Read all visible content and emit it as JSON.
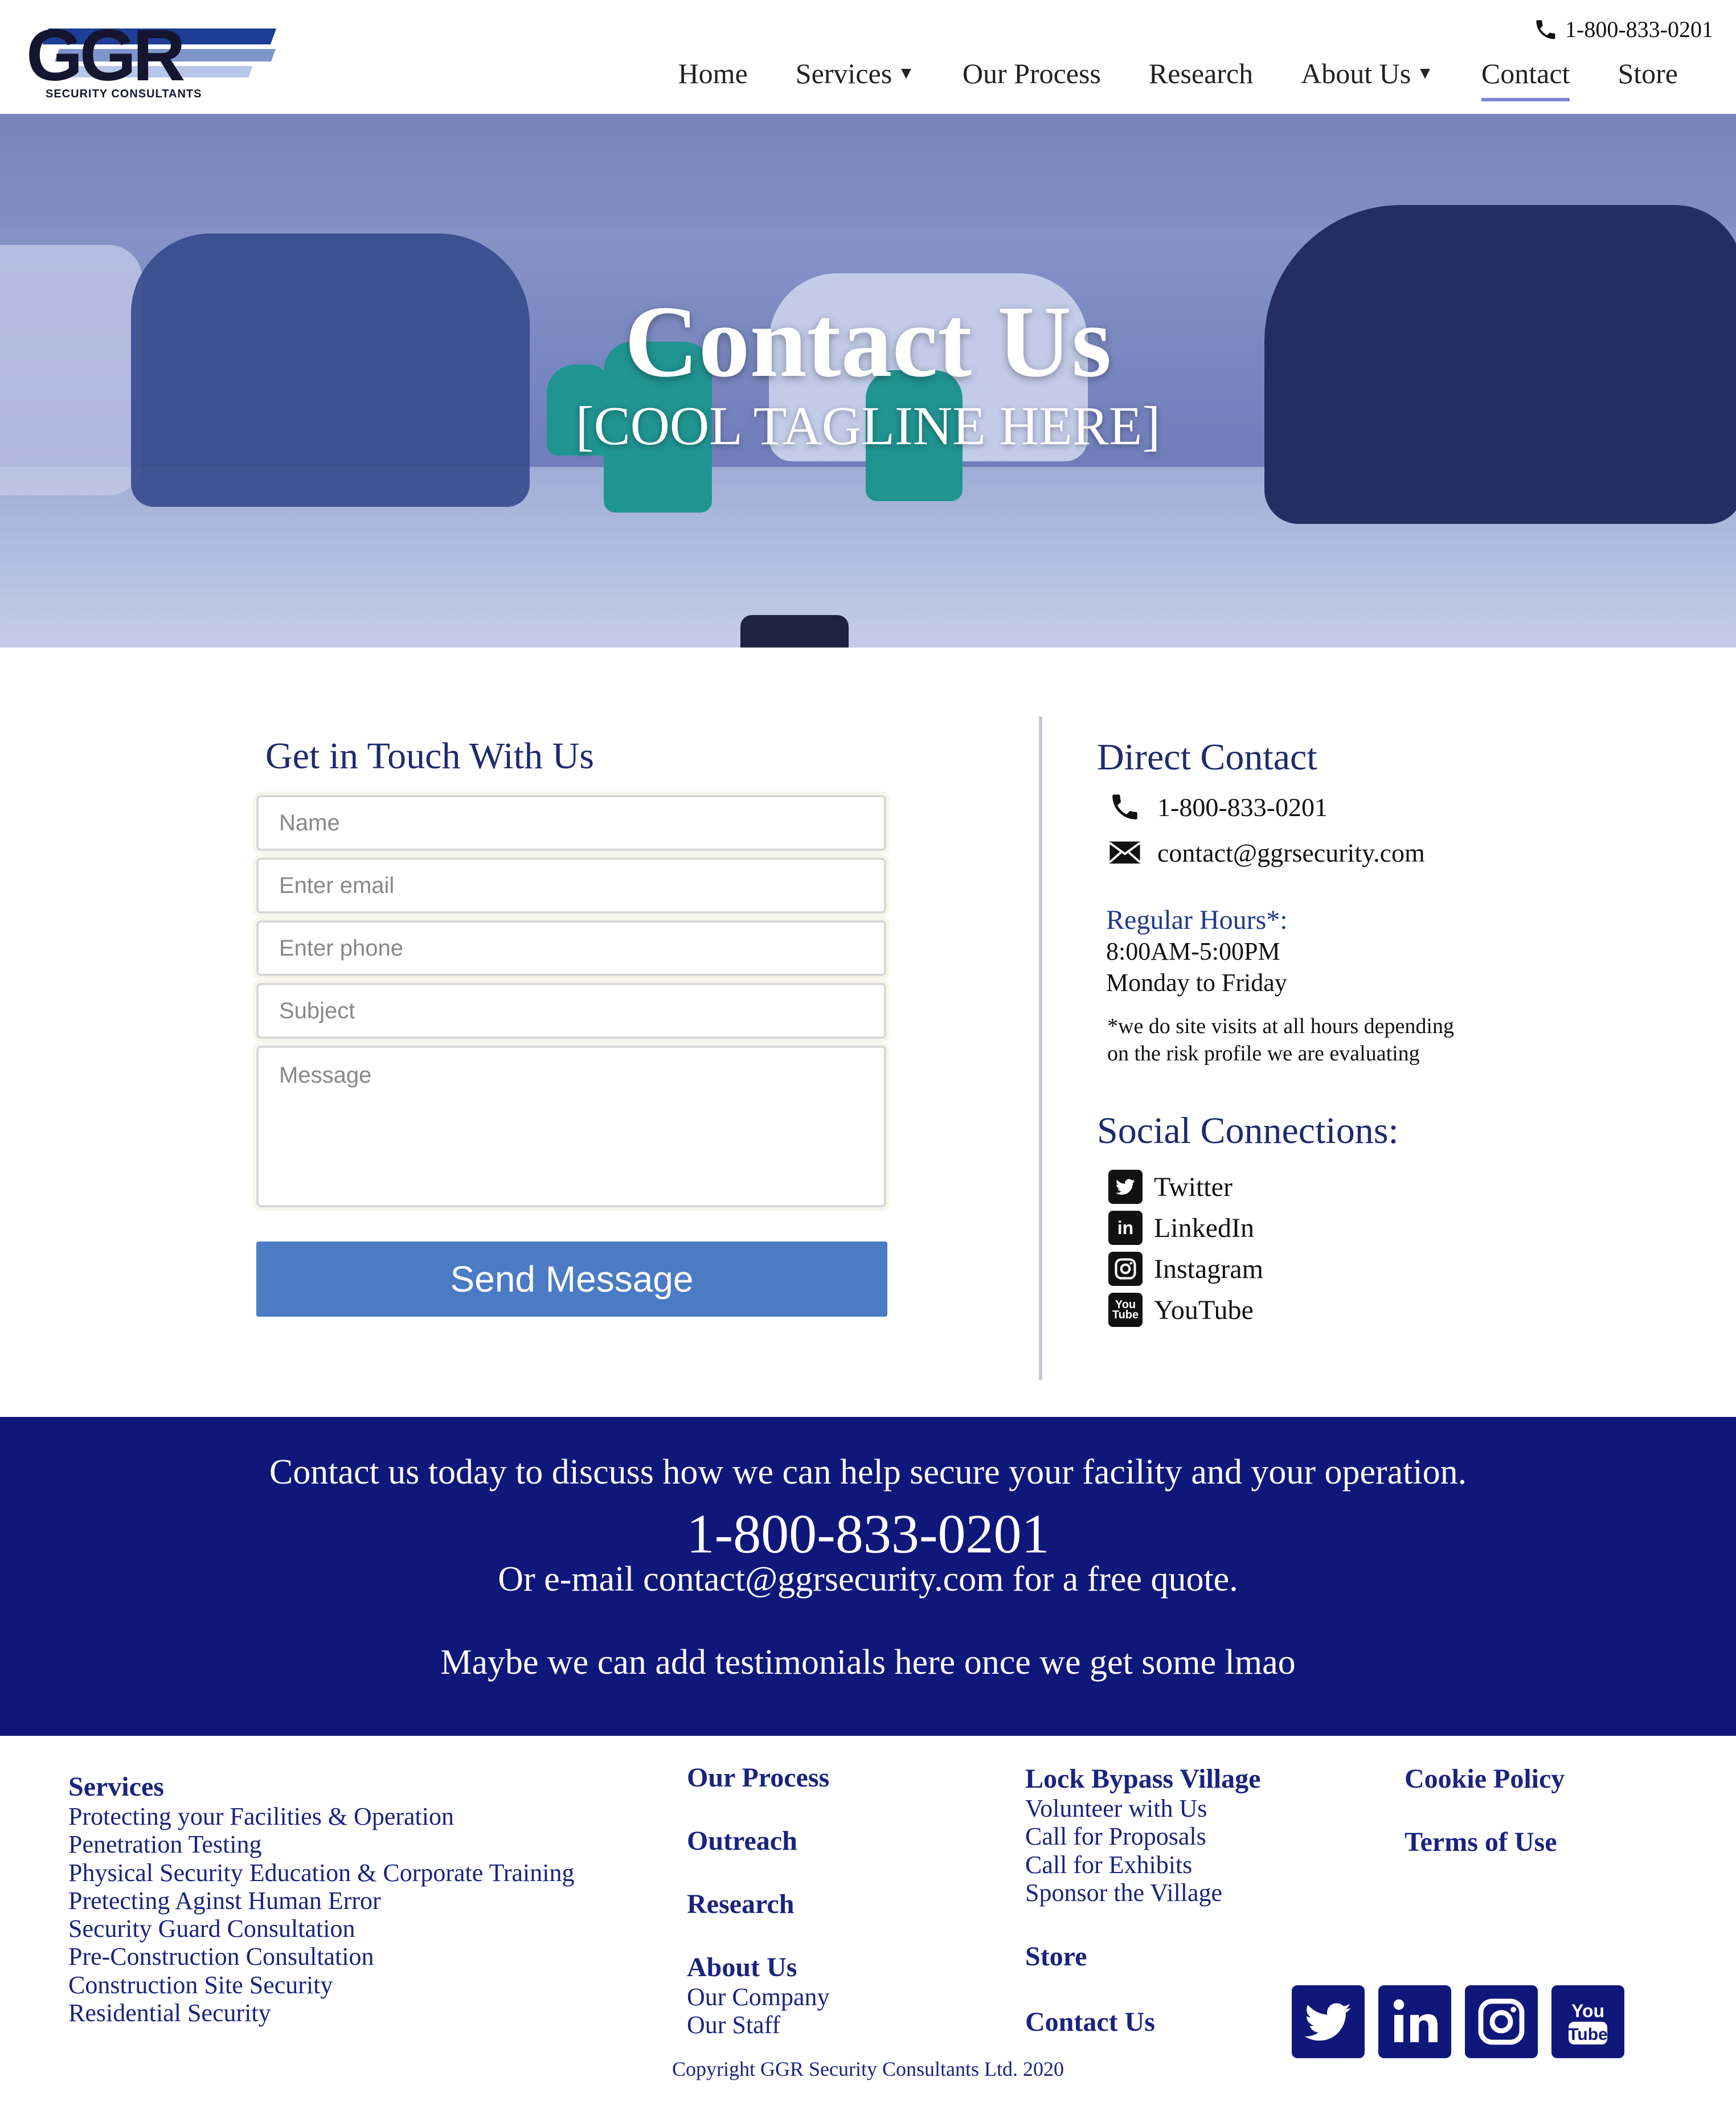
{
  "header": {
    "logo_text": "GGR",
    "logo_sub": "SECURITY CONSULTANTS",
    "phone": "1-800-833-0201",
    "nav": [
      {
        "label": "Home",
        "caret": ""
      },
      {
        "label": "Services",
        "caret": "▼"
      },
      {
        "label": "Our Process",
        "caret": ""
      },
      {
        "label": "Research",
        "caret": ""
      },
      {
        "label": "About Us",
        "caret": "▼"
      },
      {
        "label": "Contact",
        "caret": ""
      },
      {
        "label": "Store",
        "caret": ""
      }
    ],
    "active_nav": "Contact"
  },
  "hero": {
    "title": "Contact Us",
    "tagline": "[COOL TAGLINE HERE]",
    "slide_count": 4,
    "active_slide": 1
  },
  "form": {
    "title": "Get in Touch With Us",
    "name_placeholder": "Name",
    "email_placeholder": "Enter email",
    "phone_placeholder": "Enter phone",
    "subject_placeholder": "Subject",
    "message_placeholder": "Message",
    "submit_label": "Send Message"
  },
  "direct": {
    "title": "Direct Contact",
    "phone": "1-800-833-0201",
    "email": "contact@ggrsecurity.com",
    "hours_title": "Regular Hours*:",
    "hours_time": "8:00AM-5:00PM",
    "hours_days": "Monday to Friday",
    "note_line1": "*we do site visits at all hours depending",
    "note_line2": "on the risk profile we are evaluating",
    "social_title": "Social Connections:",
    "social": {
      "twitter": "Twitter",
      "linkedin": "LinkedIn",
      "instagram": "Instagram",
      "youtube": "YouTube"
    }
  },
  "cta": {
    "line1": "Contact us today to discuss how we can help secure your facility and your operation.",
    "phone": "1-800-833-0201",
    "line3": "Or e-mail contact@ggrsecurity.com for a free quote.",
    "line4": "Maybe we can add testimonials here once we get some lmao"
  },
  "footer": {
    "services_title": "Services",
    "services": [
      "Protecting your Facilities & Operation",
      "Penetration Testing",
      "Physical Security Education & Corporate Training",
      "Pretecting Aginst Human Error",
      "Security Guard Consultation",
      "Pre-Construction Consultation",
      "Construction Site Security",
      "Residential Security"
    ],
    "our_process": "Our Process",
    "outreach": "Outreach",
    "research": "Research",
    "about_title": "About Us",
    "about_links": [
      "Our Company",
      "Our Staff"
    ],
    "lbv_title": "Lock Bypass Village",
    "lbv_links": [
      "Volunteer with Us",
      "Call for Proposals",
      "Call for Exhibits",
      "Sponsor the Village"
    ],
    "store": "Store",
    "contact": "Contact Us",
    "cookie": "Cookie Policy",
    "terms": "Terms of Use",
    "copyright": "Copyright GGR Security Consultants Ltd. 2020"
  },
  "colors": {
    "brand_navy": "#10177a",
    "heading_blue": "#1f2a6e",
    "button_blue": "#4b7bc3",
    "nav_underline": "#7f85d8"
  },
  "icons": [
    "phone-icon",
    "envelope-icon",
    "twitter-icon",
    "linkedin-icon",
    "instagram-icon",
    "youtube-icon",
    "caret-down-icon"
  ]
}
